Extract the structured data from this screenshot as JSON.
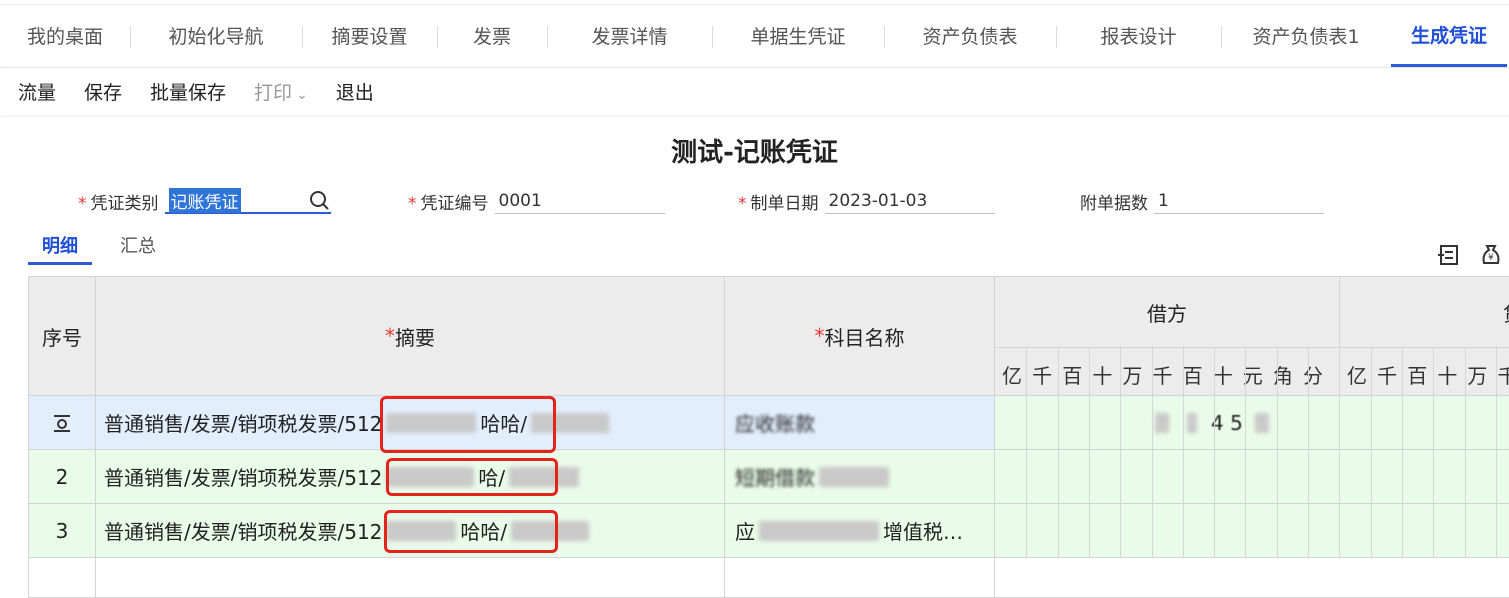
{
  "tabs": [
    {
      "label": "我的桌面"
    },
    {
      "label": "初始化导航"
    },
    {
      "label": "摘要设置"
    },
    {
      "label": "发票"
    },
    {
      "label": "发票详情"
    },
    {
      "label": "单据生凭证"
    },
    {
      "label": "资产负债表"
    },
    {
      "label": "报表设计"
    },
    {
      "label": "资产负债表1"
    },
    {
      "label": "生成凭证"
    }
  ],
  "toolbar": {
    "flow": "流量",
    "save": "保存",
    "batch_save": "批量保存",
    "print": "打印",
    "print_chevron": "⌄",
    "exit": "退出"
  },
  "voucher": {
    "title": "测试-记账凭证",
    "type_label": "凭证类别",
    "type_value": "记账凭证",
    "number_label": "凭证编号",
    "number_value": "0001",
    "date_label": "制单日期",
    "date_value": "2023-01-03",
    "attach_label": "附单据数",
    "attach_value": "1",
    "required_mark": "*"
  },
  "subtabs": {
    "detail": "明细",
    "summary": "汇总"
  },
  "table": {
    "col_seq": "序号",
    "col_summary": "摘要",
    "col_account": "科目名称",
    "col_debit": "借方",
    "col_credit": "贷",
    "debit_digits": [
      "亿",
      "千",
      "百",
      "十",
      "万",
      "千",
      "百",
      "十",
      "元",
      "角",
      "分"
    ],
    "credit_digits": [
      "亿",
      "千",
      "百",
      "十",
      "万",
      "千"
    ],
    "rows": [
      {
        "seq": "",
        "summary_prefix": "普通销售/发票/销项税发票/512",
        "summary_mid": "哈哈/",
        "account_prefix": "应收账款",
        "debit_visible": "4 5"
      },
      {
        "seq": "2",
        "summary_prefix": "普通销售/发票/销项税发票/512",
        "summary_mid": "哈/",
        "account_prefix": "短期借款",
        "debit_visible": ""
      },
      {
        "seq": "3",
        "summary_prefix": "普通销售/发票/销项税发票/512",
        "summary_mid": "哈哈/",
        "account_prefix": "应",
        "account_suffix": "增值税…",
        "debit_visible": ""
      }
    ]
  }
}
